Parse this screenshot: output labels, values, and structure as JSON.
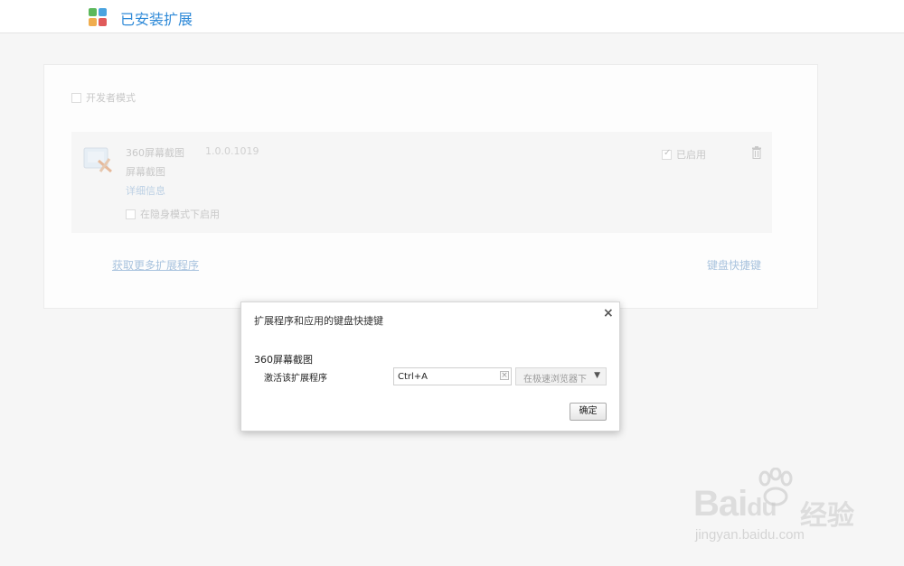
{
  "header": {
    "title": "已安装扩展"
  },
  "panel": {
    "developer_mode_label": "开发者模式",
    "extension": {
      "name": "360屏幕截图",
      "version": "1.0.0.1019",
      "description": "屏幕截图",
      "details_link": "详细信息",
      "incognito_label": "在隐身模式下启用",
      "enabled_label": "已启用",
      "enabled": true
    },
    "get_more_link": "获取更多扩展程序",
    "keyboard_shortcuts_link": "键盘快捷键"
  },
  "dialog": {
    "title": "扩展程序和应用的键盘快捷键",
    "close_glyph": "×",
    "extension_name": "360屏幕截图",
    "command_label": "激活该扩展程序",
    "shortcut_value": "Ctrl+A",
    "clear_glyph": "×",
    "scope_selected": "在极速浏览器下",
    "ok_label": "确定"
  },
  "watermark": {
    "brand": "Bai",
    "brand_du": "du",
    "brand_cn": "经验",
    "url": "jingyan.baidu.com"
  },
  "colors": {
    "accent": "#2f8ad8",
    "link_faded": "#a9c3de",
    "background": "#f6f6f6"
  }
}
